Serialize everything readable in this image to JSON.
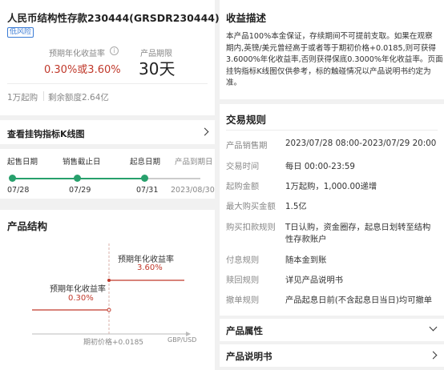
{
  "product": {
    "title": "人民币结构性存款230444(GRSDR230444)",
    "risk_badge": "低风险",
    "rate_label": "预期年化收益率",
    "rate_value": "0.30%或3.60%",
    "term_label": "产品期限",
    "term_value": "30天",
    "min_amount": "1万起购",
    "remaining": "剩余额度2.64亿"
  },
  "kline_link": "查看挂钩指标K线图",
  "timeline": {
    "steps": [
      {
        "label": "起售日期",
        "date": "07/28"
      },
      {
        "label": "销售截止日",
        "date": "07/29"
      },
      {
        "label": "起息日期",
        "date": "07/31"
      },
      {
        "label": "产品到期日",
        "date": "2023/08/30"
      }
    ]
  },
  "structure": {
    "title": "产品结构",
    "high_label": "预期年化收益率",
    "high_value": "3.60%",
    "low_label": "预期年化收益率",
    "low_value": "0.30%",
    "x_label": "期初价格+0.0185",
    "axis_unit": "GBP/USD"
  },
  "income": {
    "title": "收益描述",
    "text": "本产品100%本金保证，存续期间不可提前支取。如果在观察期内,英镑/美元曾经高于或者等于期初价格+0.0185,则可获得3.6000%年化收益率,否则获得保底0.3000%年化收益率。页面挂钩指标K线图仅供参考，标的触碰情况以产品说明书约定为准。",
    "lines": [
      "本产品100%本金保证，存续期间不可提前支取。如果在观察",
      "期内,英镑/美元曾经高于或者等于期初价格+0.0185,则可获得",
      "3.6000%年化收益率,否则获得保底0.3000%年化收益率。页面",
      "挂钩指标K线图仅供参考，标的触碰情况以产品说明书约定为",
      "准。"
    ]
  },
  "rules": {
    "title": "交易规则",
    "rows": [
      {
        "key": "产品销售期",
        "value": "2023/07/28 08:00-2023/07/29 20:00"
      },
      {
        "key": "交易时间",
        "value": "每日 00:00-23:59"
      },
      {
        "key": "起购金额",
        "value": "1万起购，1,000.00递增"
      },
      {
        "key": "最大购买金额",
        "value": "1.5亿"
      },
      {
        "key": "购买扣款规则",
        "value": "T日认购，资金圈存，起息日划转至结构",
        "value2": "性存款账户"
      },
      {
        "key": "付息规则",
        "value": "随本金到账"
      },
      {
        "key": "赎回规则",
        "value": "详见产品说明书"
      },
      {
        "key": "撤单规则",
        "value": "产品起息日前(不含起息日当日)均可撤单"
      }
    ]
  },
  "attributes_label": "产品属性",
  "manual_label": "产品说明书",
  "colors": {
    "accent_red": "#c0392b",
    "accent_green": "#27a06c",
    "badge_blue": "#3a7bd5"
  }
}
